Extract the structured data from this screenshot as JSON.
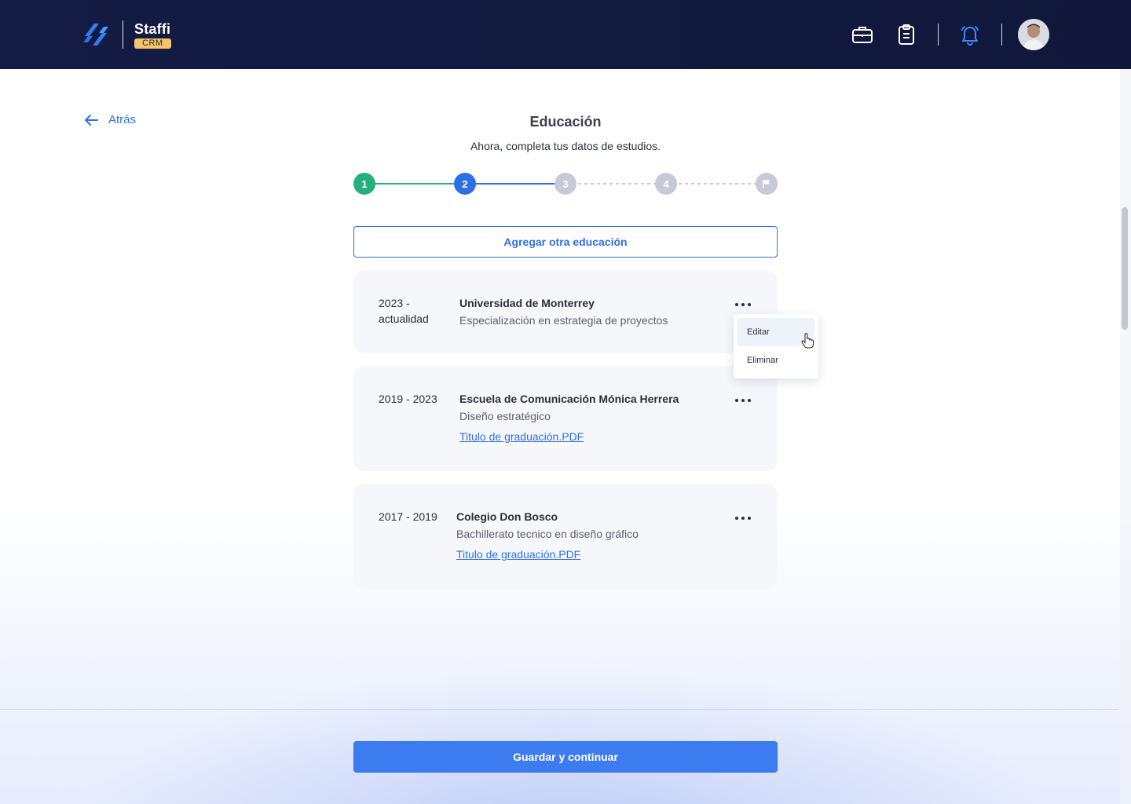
{
  "header": {
    "brand_name": "Staffi",
    "brand_badge": "CRM",
    "icons": [
      "logo-mark-icon",
      "briefcase-icon",
      "clipboard-icon",
      "bell-icon",
      "avatar"
    ]
  },
  "nav": {
    "back_label": "Atrás"
  },
  "page": {
    "title": "Educación",
    "subtitle": "Ahora, completa tus datos de estudios."
  },
  "stepper": {
    "steps": [
      "1",
      "2",
      "3",
      "4"
    ],
    "current": 2,
    "colors": {
      "done": "#22b07d",
      "current": "#2f6fe6",
      "pending": "#c7c9d9"
    }
  },
  "add_button": {
    "label": "Agregar otra educación"
  },
  "education": [
    {
      "period": "2023 -\nactualidad",
      "institution": "Universidad de Monterrey",
      "program": "Especialización en estrategia de proyectos",
      "file": ""
    },
    {
      "period": "2019 - 2023",
      "institution": "Escuela de Comunicación Mónica Herrera",
      "program": "Diseño estratégico",
      "file": "Titulo de graduación.PDF"
    },
    {
      "period": "2017 - 2019",
      "institution": "Colegio Don Bosco",
      "program": "Bachillerato tecnico en diseño gráfico",
      "file": "Titulo de graduación.PDF"
    }
  ],
  "menu": {
    "edit_label": "Editar",
    "delete_label": "Eliminar"
  },
  "footer": {
    "save_label": "Guardar y continuar"
  },
  "colors": {
    "header_bg": "#131a42",
    "primary": "#2f6fe6",
    "card_bg": "#f6f7fb",
    "badge": "#f5c46b"
  }
}
